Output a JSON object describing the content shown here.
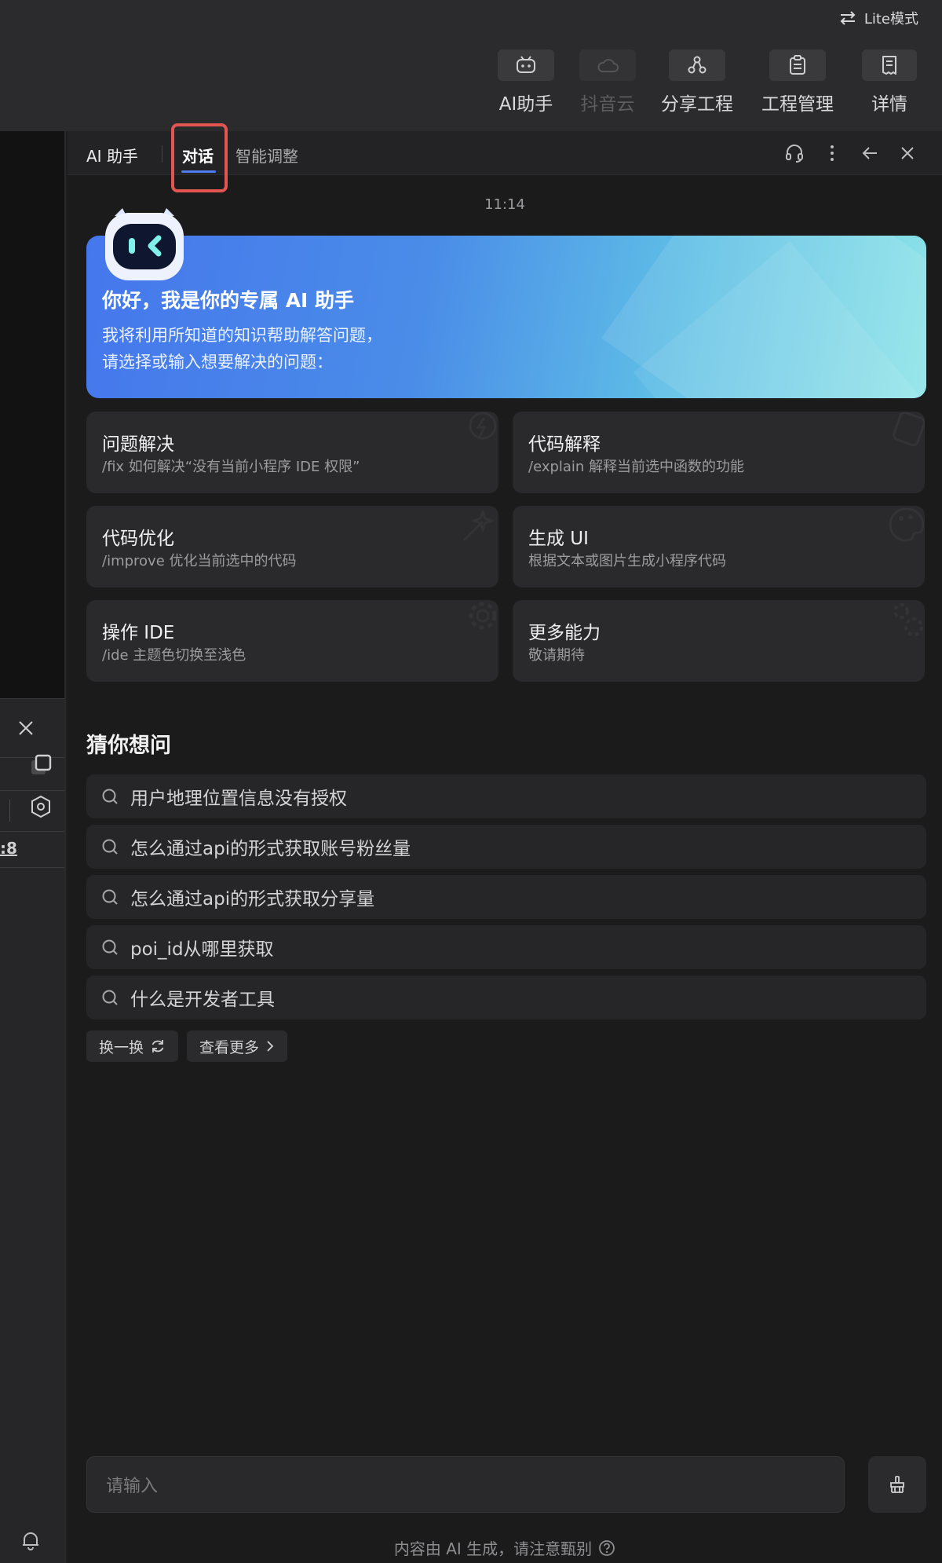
{
  "topbar": {
    "lite_mode": "Lite模式",
    "tools": [
      {
        "label": "AI助手",
        "icon": "robot-icon",
        "enabled": true
      },
      {
        "label": "抖音云",
        "icon": "cloud-icon",
        "enabled": false
      },
      {
        "label": "分享工程",
        "icon": "share-icon",
        "enabled": true
      },
      {
        "label": "工程管理",
        "icon": "clipboard-icon",
        "enabled": true
      },
      {
        "label": "详情",
        "icon": "document-icon",
        "enabled": true
      }
    ]
  },
  "left_panel": {
    "number": ":8"
  },
  "panel": {
    "title": "AI 助手",
    "tabs": [
      {
        "label": "对话",
        "active": true
      },
      {
        "label": "智能调整",
        "active": false
      }
    ],
    "header_icons": [
      "headset-icon",
      "more-vertical-icon",
      "arrow-left-icon",
      "close-icon"
    ],
    "timestamp": "11:14",
    "welcome": {
      "title": "你好，我是你的专属 AI 助手",
      "line1": "我将利用所知道的知识帮助解答问题，",
      "line2": "请选择或输入想要解决的问题："
    },
    "cards": [
      {
        "title": "问题解决",
        "desc": "/fix 如何解决“没有当前小程序 IDE 权限”"
      },
      {
        "title": "代码解释",
        "desc": "/explain 解释当前选中函数的功能"
      },
      {
        "title": "代码优化",
        "desc": "/improve 优化当前选中的代码"
      },
      {
        "title": "生成 UI",
        "desc": "根据文本或图片生成小程序代码"
      },
      {
        "title": "操作 IDE",
        "desc": "/ide 主题色切换至浅色"
      },
      {
        "title": "更多能力",
        "desc": "敬请期待"
      }
    ],
    "guess_title": "猜你想问",
    "questions": [
      "用户地理位置信息没有授权",
      "怎么通过api的形式获取账号粉丝量",
      "怎么通过api的形式获取分享量",
      "poi_id从哪里获取",
      "什么是开发者工具"
    ],
    "refresh_label": "换一换",
    "more_label": "查看更多",
    "input_placeholder": "请输入",
    "footer_note": "内容由 AI 生成，请注意甄别"
  },
  "colors": {
    "accent": "#4d7cf3",
    "highlight": "#e25550",
    "background": "#1b1b1c"
  }
}
